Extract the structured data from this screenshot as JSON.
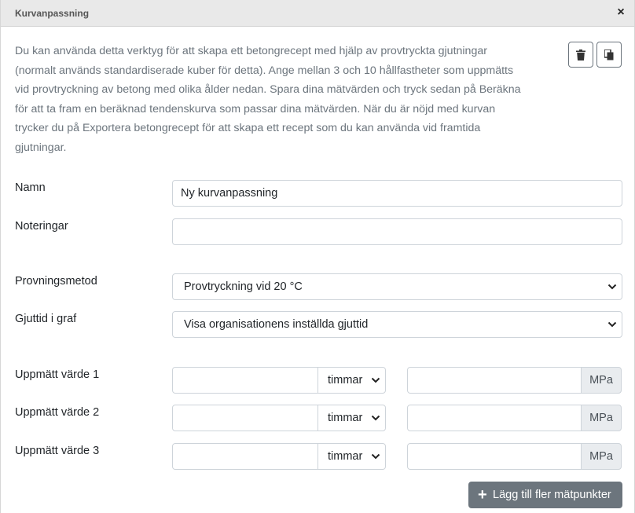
{
  "dialog": {
    "title": "Kurvanpassning",
    "close_symbol": "×",
    "description": "Du kan använda detta verktyg för att skapa ett betongrecept med hjälp av provtryckta gjutningar (normalt används standardiserade kuber för detta). Ange mellan 3 och 10 hållfastheter som uppmätts vid provtryckning av betong med olika ålder nedan. Spara dina mätvärden och tryck sedan på Beräkna för att ta fram en beräknad tendenskurva som passar dina mätvärden. När du är nöjd med kurvan trycker du på Exportera betongrecept för att skapa ett recept som du kan använda vid framtida gjutningar.",
    "icons": {
      "delete": "trash-icon",
      "copy": "copy-icon"
    }
  },
  "form": {
    "name_label": "Namn",
    "name_value": "Ny kurvanpassning",
    "notes_label": "Noteringar",
    "notes_value": "",
    "method_label": "Provningsmetod",
    "method_value": "Provtryckning vid 20 °C",
    "casttime_label": "Gjuttid i graf",
    "casttime_value": "Visa organisationens inställda gjuttid"
  },
  "measurements": [
    {
      "label": "Uppmätt värde 1",
      "time_value": "",
      "unit": "timmar",
      "value": "",
      "value_unit": "MPa"
    },
    {
      "label": "Uppmätt värde 2",
      "time_value": "",
      "unit": "timmar",
      "value": "",
      "value_unit": "MPa"
    },
    {
      "label": "Uppmätt värde 3",
      "time_value": "",
      "unit": "timmar",
      "value": "",
      "value_unit": "MPa"
    }
  ],
  "actions": {
    "add_label": "Lägg till fler mätpunkter",
    "add_symbol": "+"
  },
  "colors": {
    "secondary": "#6c757d",
    "titlebar": "#e9e9e9",
    "input_border": "#ced4da"
  }
}
